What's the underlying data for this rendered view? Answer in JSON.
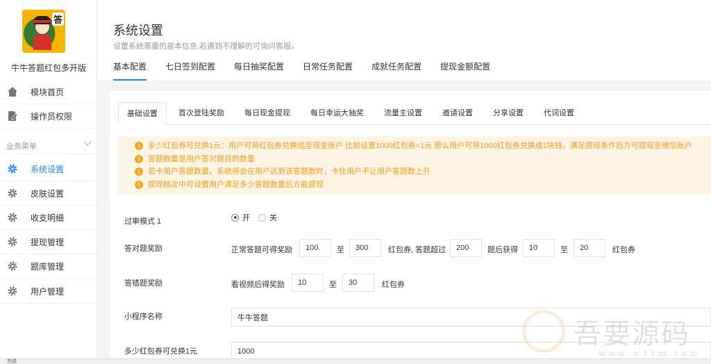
{
  "app": {
    "name": "牛牛答题红包多开版",
    "logo_mark": "答"
  },
  "sidebar": {
    "items_top": [
      {
        "label": "模块首页",
        "icon": "home-icon"
      },
      {
        "label": "操作员权限",
        "icon": "edit-doc-icon"
      }
    ],
    "section_label": "业务菜单",
    "items": [
      {
        "label": "系统设置",
        "icon": "gear-icon",
        "active": true
      },
      {
        "label": "皮肤设置",
        "icon": "gear-icon"
      },
      {
        "label": "收支明细",
        "icon": "gear-icon"
      },
      {
        "label": "提现管理",
        "icon": "gear-icon"
      },
      {
        "label": "题库管理",
        "icon": "gear-icon"
      },
      {
        "label": "用户管理",
        "icon": "gear-icon"
      }
    ]
  },
  "header": {
    "title": "系统设置",
    "subtitle": "设置系统需要的基本信息,若遇到不理解的可询问客服。",
    "tabs": [
      "基本配置",
      "七日签到配置",
      "每日抽奖配置",
      "日常任务配置",
      "成就任务配置",
      "提现金额配置"
    ]
  },
  "inner_tabs": [
    "基础设置",
    "首次登陆奖励",
    "每日现金提现",
    "每日幸运大抽奖",
    "流量主设置",
    "邀请设置",
    "分享设置",
    "代词设置"
  ],
  "notice": [
    "多少红包券可兑换1元：用户可将红包券兑换成至现金账户 比如设置1000红包券=1元 那么用户可将1000红包券兑换成1块钱，满足提现条件后方可提现至微信账户",
    "答题数量是用户答对题目的数量",
    "若卡用户答题数量，系统将会在用户达到该答题数时，卡住用户不让用户答题数上升",
    "提现档次中可设置用户满足多少答题数量后方能提现"
  ],
  "form": {
    "review_mode": {
      "label": "过审模式 1",
      "on_label": "开",
      "off_label": "关",
      "value": "开"
    },
    "correct_reward": {
      "label": "答对题奖励",
      "prefix": "正常答题可得奖励",
      "min": "100",
      "to1": "至",
      "max": "300",
      "mid": "红包券, 答题超过",
      "threshold": "200",
      "after": "题后获得",
      "min2": "10",
      "to2": "至",
      "max2": "20",
      "suffix": "红包券"
    },
    "wrong_reward": {
      "label": "答错题奖励",
      "prefix": "看视频后得奖励",
      "min": "10",
      "to": "至",
      "max": "30",
      "suffix": "红包券"
    },
    "mini_program_name": {
      "label": "小程序名称",
      "value": "牛牛答题"
    },
    "exchange_rate": {
      "label": "多少红包券可兑换1元",
      "value": "1000"
    }
  },
  "watermark": {
    "text": "吾要源码",
    "url": "www.w1ym.com"
  },
  "status_bar": {
    "text": "完成"
  },
  "colors": {
    "accent": "#1e88e5",
    "notice_text": "#f39c12",
    "notice_bg": "#fdf4e6"
  }
}
